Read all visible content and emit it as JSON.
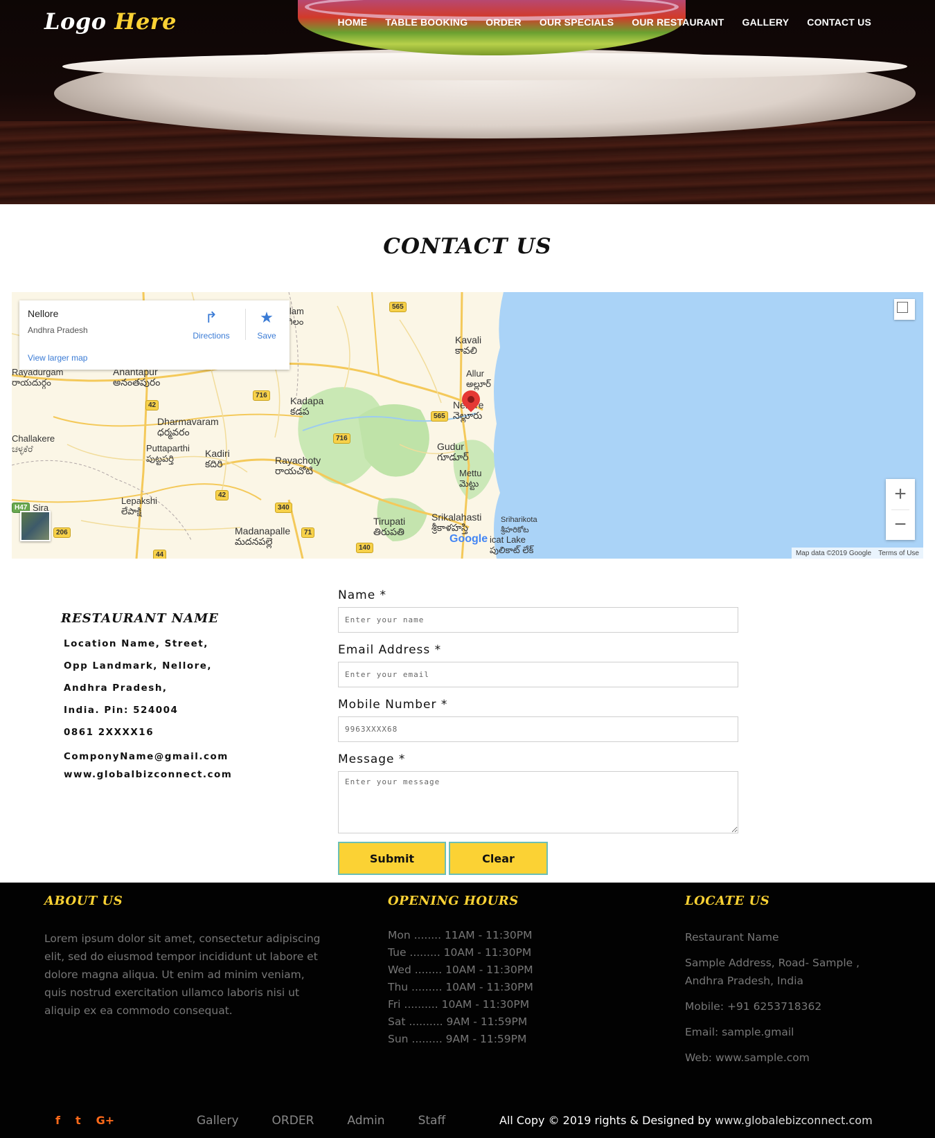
{
  "header": {
    "logo_part1": "Logo ",
    "logo_part2": "Here",
    "nav": [
      "HOME",
      "TABLE BOOKING",
      "ORDER",
      "OUR SPECIALS",
      "OUR RESTAURANT",
      "GALLERY",
      "CONTACT US"
    ]
  },
  "page_title": "CONTACT US",
  "map": {
    "place": "Nellore",
    "region": "Andhra Pradesh",
    "directions_label": "Directions",
    "save_label": "Save",
    "larger_map": "View larger map",
    "map_data": "Map data ©2019 Google",
    "terms": "Terms of Use",
    "google_logo": "Google",
    "zoom_in": "+",
    "zoom_out": "−",
    "towns": [
      {
        "name": "Kavali",
        "local": "కావలి"
      },
      {
        "name": "Allur",
        "local": "అల్లూర్"
      },
      {
        "name": "Nellore",
        "local": "నెల్లూరు"
      },
      {
        "name": "Gudur",
        "local": "గూడూర్"
      },
      {
        "name": "Mettu",
        "local": "మెట్టు"
      },
      {
        "name": "Anantapur",
        "local": "అనంతపురం"
      },
      {
        "name": "Rayadurgam",
        "local": "రాయదుర్గం"
      },
      {
        "name": "Dharmavaram",
        "local": "ధర్మవరం"
      },
      {
        "name": "Kadapa",
        "local": "కడప"
      },
      {
        "name": "Challakere",
        "local": "ಚಳ್ಳಕೆರೆ"
      },
      {
        "name": "Puttaparthi",
        "local": "పుట్టపర్తి"
      },
      {
        "name": "Kadiri",
        "local": "కదిరి"
      },
      {
        "name": "Rayachoty",
        "local": "రాయచోటి"
      },
      {
        "name": "Lepakshi",
        "local": "లేపాక్షి"
      },
      {
        "name": "Sira",
        "local": ""
      },
      {
        "name": "Madanapalle",
        "local": "మదనపల్లె"
      },
      {
        "name": "Tirupati",
        "local": "తిరుపతి"
      },
      {
        "name": "Srikalahasti",
        "local": "శ్రీకాళహస్తి"
      },
      {
        "name": "Sriharikota",
        "local": "శ్రీహరికోట"
      },
      {
        "name": "icat Lake",
        "local": "పులికాట్ లేక్"
      },
      {
        "name": "ilam",
        "local": "గిలం"
      }
    ],
    "routes": [
      "565",
      "716",
      "565",
      "42",
      "716",
      "42",
      "340",
      "71",
      "140",
      "206",
      "44",
      "H47"
    ]
  },
  "contact": {
    "title": "RESTAURANT NAME",
    "lines": [
      "Location Name, Street,",
      "Opp Landmark, Nellore,",
      "Andhra Pradesh,",
      "India. Pin: 524004",
      "0861 2XXXX16",
      "ComponyName@gmail.com",
      "www.globalbizconnect.com"
    ]
  },
  "form": {
    "name_label": "Name *",
    "name_placeholder": "Enter your name",
    "email_label": "Email Address *",
    "email_placeholder": "Enter your email",
    "mobile_label": "Mobile Number *",
    "mobile_placeholder": "9963XXXX68",
    "message_label": "Message *",
    "message_placeholder": "Enter your message",
    "submit": "Submit",
    "clear": "Clear"
  },
  "footer": {
    "about_title": "ABOUT US",
    "about_text": "Lorem ipsum dolor sit amet, consectetur adipiscing elit, sed do eiusmod tempor incididunt ut labore et dolore magna aliqua. Ut enim ad minim veniam, quis nostrud exercitation ullamco laboris nisi ut aliquip ex ea commodo consequat.",
    "hours_title": "OPENING HOURS",
    "hours": [
      "Mon ........ 11AM - 11:30PM",
      "Tue ......... 10AM - 11:30PM",
      "Wed ........ 10AM - 11:30PM",
      "Thu ......... 10AM - 11:30PM",
      "Fri .......... 10AM - 11:30PM",
      "Sat .......... 9AM - 11:59PM",
      "Sun ......... 9AM - 11:59PM"
    ],
    "locate_title": "LOCATE US",
    "locate": [
      "Restaurant Name",
      "Sample Address, Road- Sample , Andhra Pradesh, India",
      "Mobile: +91 6253718362",
      "Email: sample.gmail",
      "Web: www.sample.com"
    ],
    "social": [
      "f",
      "t",
      "G+"
    ],
    "links": [
      "Gallery",
      "ORDER",
      "Admin",
      "Staff"
    ],
    "copy_text": "All Copy © 2019 rights & Designed by ",
    "copy_link": "www.globalebizconnect.com"
  },
  "colors": {
    "accent": "#fbd234",
    "footer_bg": "#020202",
    "social": "#ff6a1a",
    "sea": "#aad3f7"
  }
}
